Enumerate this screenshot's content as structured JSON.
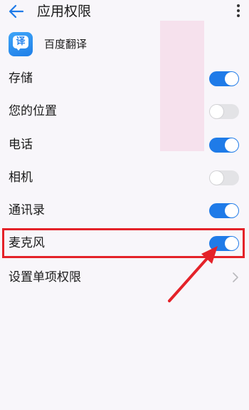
{
  "header": {
    "title": "应用权限",
    "back_icon": "arrow-left-icon",
    "more_icon": "more-vertical-icon"
  },
  "app": {
    "name": "百度翻译",
    "icon_glyph": "译",
    "icon_name": "baidu-translate-app-icon"
  },
  "permissions": [
    {
      "label": "存储",
      "enabled": true
    },
    {
      "label": "您的位置",
      "enabled": false
    },
    {
      "label": "电话",
      "enabled": true
    },
    {
      "label": "相机",
      "enabled": false
    },
    {
      "label": "通讯录",
      "enabled": true
    },
    {
      "label": "麦克风",
      "enabled": true
    }
  ],
  "individual_permissions": {
    "label": "设置单项权限",
    "icon": "chevron-right-icon"
  },
  "annotation": {
    "highlight_color": "#e42229",
    "highlighted_item": "麦克风"
  },
  "colors": {
    "toggle_on": "#1f7be8",
    "toggle_off": "#e3e3e6",
    "background": "#f8f6fa"
  }
}
